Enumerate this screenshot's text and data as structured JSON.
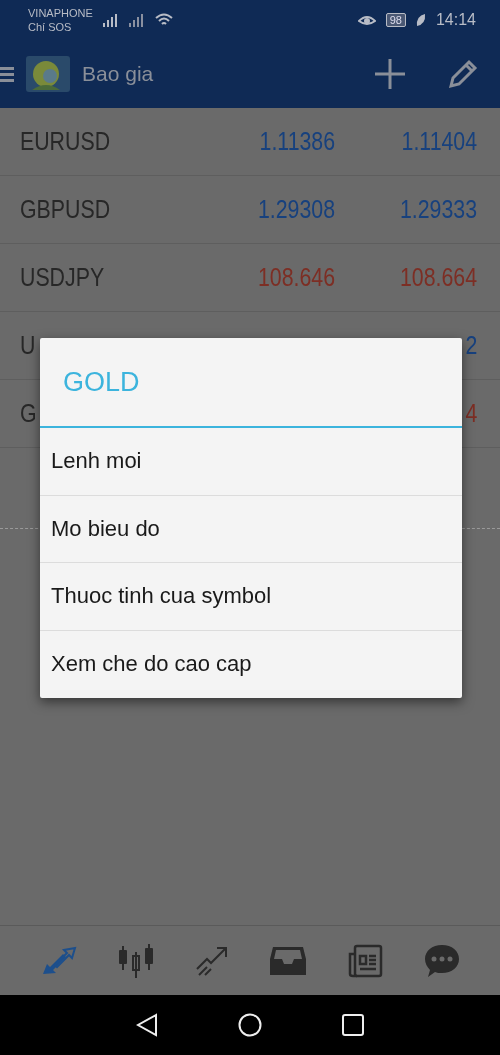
{
  "status_bar": {
    "carrier": "VINAPHONE",
    "carrier_note": "Chí SOS",
    "battery": "98",
    "time": "14:14"
  },
  "app_bar": {
    "title": "Bao gia"
  },
  "quotes": [
    {
      "symbol": "EURUSD",
      "bid": "1.11386",
      "ask": "1.11404",
      "color": "#17417e"
    },
    {
      "symbol": "GBPUSD",
      "bid": "1.29308",
      "ask": "1.29333",
      "color": "#17417e"
    },
    {
      "symbol": "USDJPY",
      "bid": "108.646",
      "ask": "108.664",
      "color": "#7d2e24"
    },
    {
      "symbol": "U",
      "ask": "2",
      "color": "#17417e"
    },
    {
      "symbol": "G",
      "ask": "4",
      "color": "#7d2e24"
    }
  ],
  "dialog": {
    "title": "GOLD",
    "items": [
      "Lenh moi",
      "Mo bieu do",
      "Thuoc tinh cua symbol",
      "Xem che do cao cap"
    ]
  },
  "bottom_tabs": [
    {
      "kind": "quotes",
      "selected": true
    },
    {
      "kind": "chart",
      "selected": false
    },
    {
      "kind": "trade",
      "selected": false
    },
    {
      "kind": "history",
      "selected": false
    },
    {
      "kind": "news",
      "selected": false
    },
    {
      "kind": "chat",
      "selected": false
    }
  ]
}
